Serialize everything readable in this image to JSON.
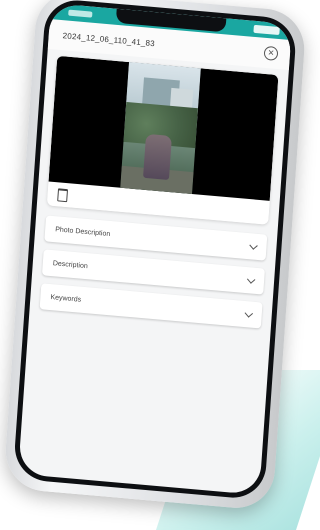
{
  "screen": {
    "title": "2024_12_06_110_41_83",
    "close_icon": "close-circle-icon",
    "photo_alt": "uploaded photo preview",
    "delete_icon": "trash-icon"
  },
  "dropdowns": [
    {
      "label": "Photo Description"
    },
    {
      "label": "Description"
    },
    {
      "label": "Keywords"
    }
  ],
  "colors": {
    "status_bar": "#1aa7a1",
    "accent_glow": "#a0e4de"
  }
}
